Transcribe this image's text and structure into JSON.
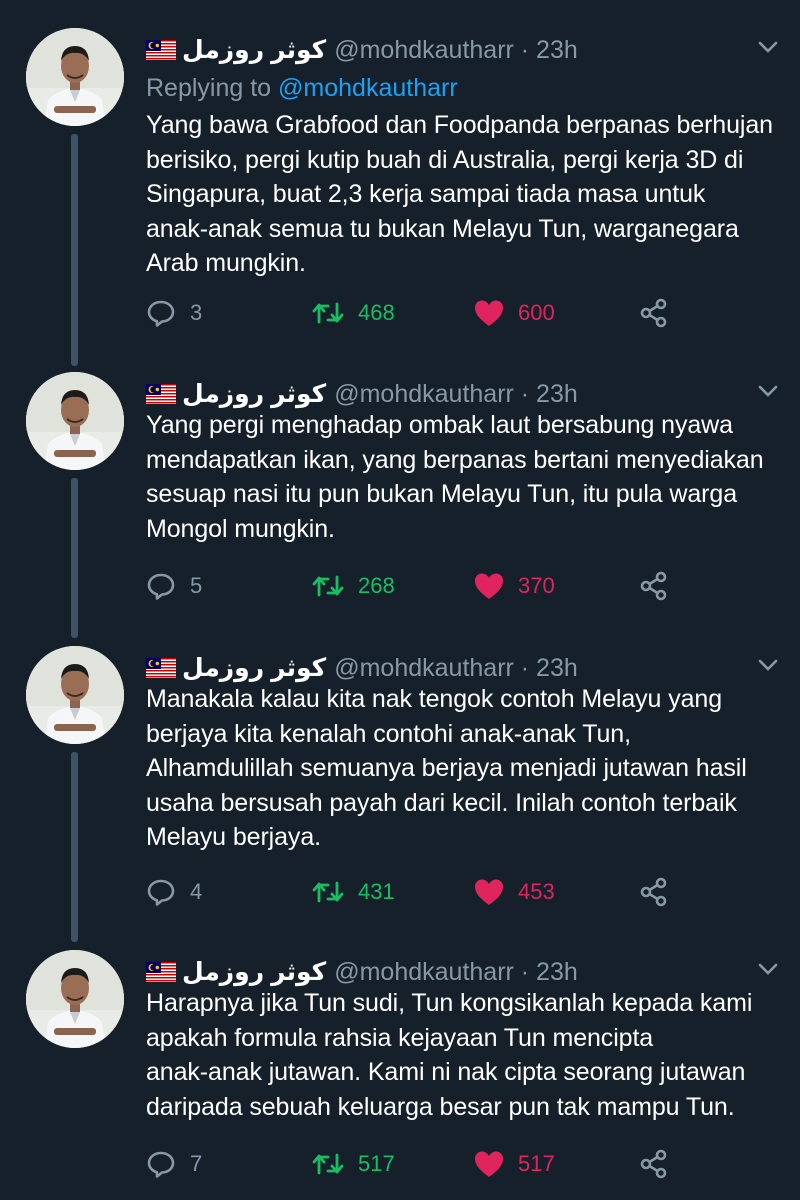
{
  "tweets": [
    {
      "display_name": "كوثر روزمل",
      "handle": "@mohdkautharr · 23h",
      "replying_label": "Replying to",
      "replying_to": "@mohdkautharr",
      "text": "Yang bawa Grabfood dan Foodpanda berpanas berhujan\nberisiko, pergi kutip buah di Australia, pergi kerja 3D di\nSingapura, buat 2,3 kerja sampai tiada masa untuk\nanak-anak semua tu bukan Melayu Tun,  warganegara\nArab mungkin.",
      "replies": "3",
      "retweets": "468",
      "likes": "600"
    },
    {
      "display_name": "كوثر روزمل",
      "handle": "@mohdkautharr · 23h",
      "text": "Yang pergi menghadap ombak laut bersabung nyawa\nmendapatkan ikan, yang berpanas bertani menyediakan\nsesuap nasi itu pun bukan Melayu Tun, itu pula warga\nMongol mungkin.",
      "replies": "5",
      "retweets": "268",
      "likes": "370"
    },
    {
      "display_name": "كوثر روزمل",
      "handle": "@mohdkautharr · 23h",
      "text": "Manakala kalau kita nak tengok contoh Melayu yang\nberjaya kita kenalah contohi anak-anak Tun,\nAlhamdulillah semuanya berjaya menjadi jutawan hasil\nusaha bersusah payah dari kecil. Inilah contoh terbaik\nMelayu berjaya.",
      "replies": "4",
      "retweets": "431",
      "likes": "453"
    },
    {
      "display_name": "كوثر روزمل",
      "handle": "@mohdkautharr · 23h",
      "text": "Harapnya jika Tun sudi, Tun kongsikanlah kepada kami\napakah formula rahsia kejayaan Tun mencipta\nanak-anak jutawan. Kami ni nak cipta seorang jutawan\ndaripada sebuah keluarga besar pun tak mampu Tun.",
      "replies": "7",
      "retweets": "517",
      "likes": "517"
    }
  ],
  "colors": {
    "background": "#15202b",
    "secondary_text": "#8899a6",
    "mention": "#1da1f2",
    "retweet": "#17bf63",
    "like": "#e0245e",
    "thread_line": "#3d5466"
  },
  "icons": [
    "flag-malaysia-icon",
    "chevron-down-icon",
    "reply-icon",
    "retweet-icon",
    "like-heart-icon",
    "share-icon"
  ]
}
